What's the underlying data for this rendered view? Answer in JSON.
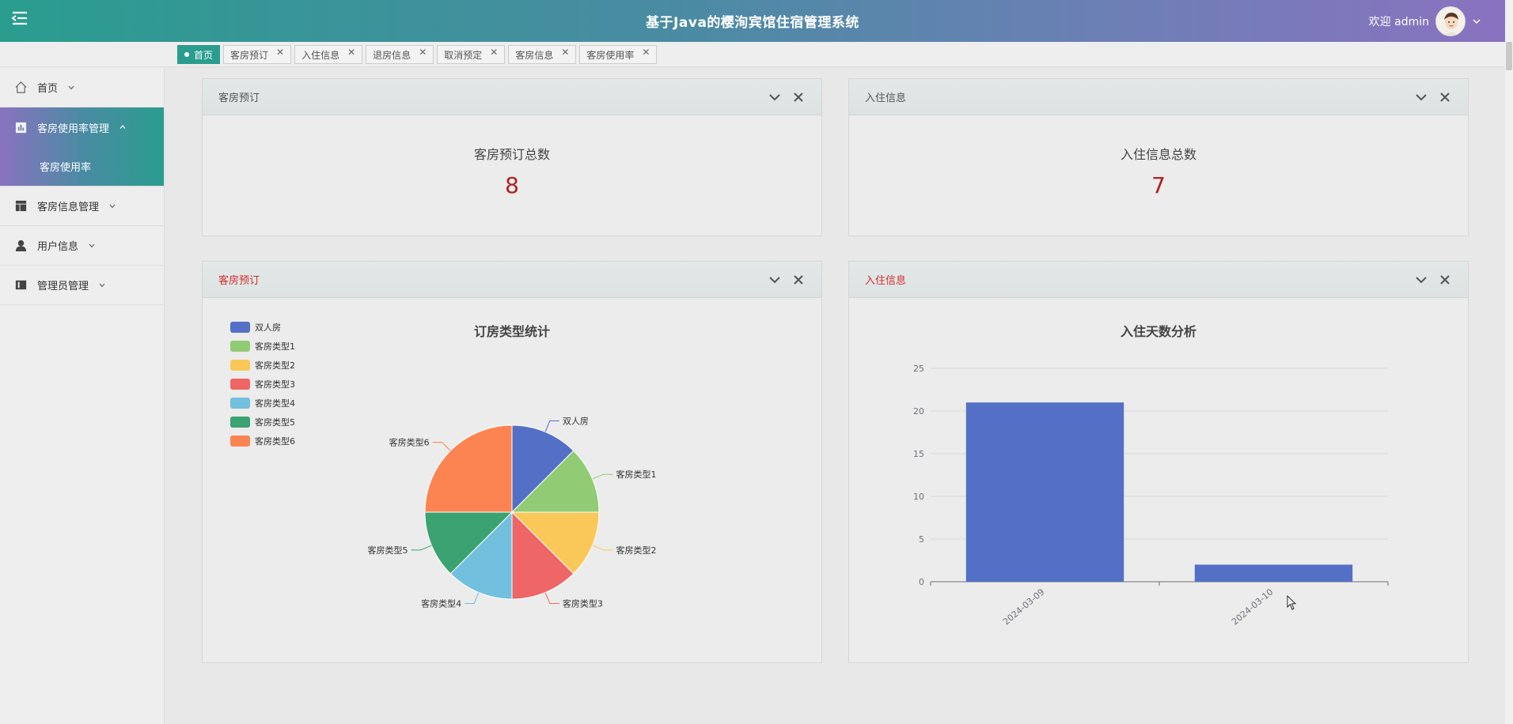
{
  "header": {
    "title": "基于Java的樱洵宾馆住宿管理系统",
    "welcome": "欢迎 admin"
  },
  "tabs": [
    {
      "label": "首页",
      "active": true
    },
    {
      "label": "客房预订",
      "active": false
    },
    {
      "label": "入住信息",
      "active": false
    },
    {
      "label": "退房信息",
      "active": false
    },
    {
      "label": "取消预定",
      "active": false
    },
    {
      "label": "客房信息",
      "active": false
    },
    {
      "label": "客房使用率",
      "active": false
    }
  ],
  "sidebar": {
    "items": [
      {
        "label": "首页",
        "icon": "home-icon"
      },
      {
        "label": "客房使用率管理",
        "icon": "chart-icon",
        "open": true,
        "sub": [
          "客房使用率"
        ]
      },
      {
        "label": "客房信息管理",
        "icon": "layout-icon"
      },
      {
        "label": "用户信息",
        "icon": "user-icon"
      },
      {
        "label": "管理员管理",
        "icon": "admin-icon"
      }
    ]
  },
  "panels": {
    "booking_stat": {
      "title": "客房预订",
      "label": "客房预订总数",
      "value": "8"
    },
    "checkin_stat": {
      "title": "入住信息",
      "label": "入住信息总数",
      "value": "7"
    },
    "booking_chart": {
      "title": "客房预订"
    },
    "checkin_chart": {
      "title": "入住信息"
    }
  },
  "colors": {
    "accent": "#2a9d8f",
    "value_red": "#b21f1f",
    "bar": "#5470c6"
  },
  "chart_data": [
    {
      "type": "pie",
      "title": "订房类型统计",
      "legend_position": "top-left",
      "categories": [
        "双人房",
        "客房类型1",
        "客房类型2",
        "客房类型3",
        "客房类型4",
        "客房类型5",
        "客房类型6"
      ],
      "values": [
        1,
        1,
        1,
        1,
        1,
        1,
        2
      ],
      "colors": [
        "#5470c6",
        "#91cc75",
        "#fac858",
        "#ee6666",
        "#73c0de",
        "#3ba272",
        "#fc8452"
      ]
    },
    {
      "type": "bar",
      "title": "入住天数分析",
      "categories": [
        "2024-03-09",
        "2024-03-10"
      ],
      "values": [
        21,
        2
      ],
      "ylim": [
        0,
        25
      ],
      "yticks": [
        0,
        5,
        10,
        15,
        20,
        25
      ],
      "grid": true
    }
  ]
}
